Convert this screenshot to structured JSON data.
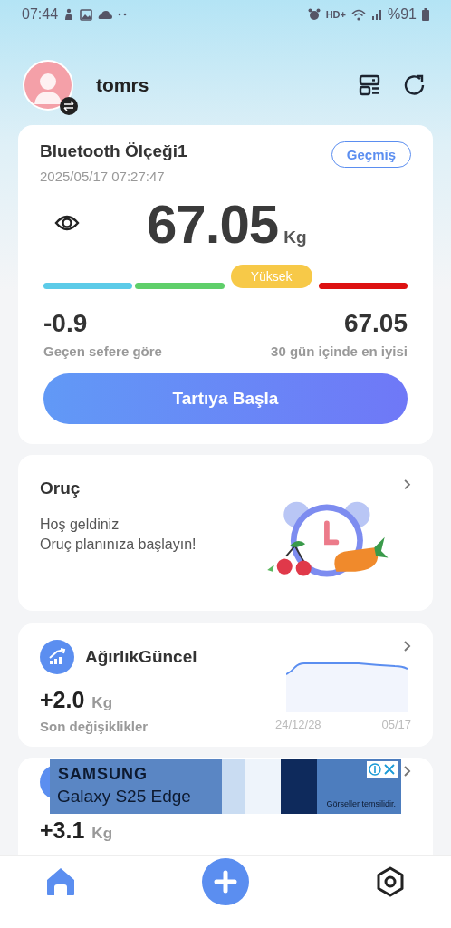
{
  "status_bar": {
    "time": "07:44",
    "network": "HD+",
    "battery": "%91"
  },
  "header": {
    "username": "tomrs"
  },
  "scale_card": {
    "title": "Bluetooth Ölçeği1",
    "history_button": "Geçmiş",
    "timestamp": "2025/05/17 07:27:47",
    "weight": "67.05",
    "unit": "Kg",
    "segments": [
      {
        "color": "#5ccbe8",
        "selected": false
      },
      {
        "color": "#5fcf6a",
        "selected": false
      },
      {
        "color": "#f7c948",
        "selected": true,
        "label": "Yüksek"
      },
      {
        "color": "#dd1111",
        "selected": false
      }
    ],
    "stats": [
      {
        "value": "-0.9",
        "label": "Geçen sefere göre"
      },
      {
        "value": "67.05",
        "label": "30 gün içinde en iyisi"
      }
    ],
    "start_button": "Tartıya Başla"
  },
  "fasting_card": {
    "title": "Oruç",
    "lines": [
      "Hoş geldiniz",
      "Oruç planınıza başlayın!"
    ]
  },
  "trend_card": {
    "title": "AğırlıkGüncel",
    "value": "+2.0",
    "unit": "Kg",
    "caption": "Son değişiklikler",
    "x_labels": [
      "24/12/28",
      "05/17"
    ]
  },
  "next_card": {
    "value": "+3.1",
    "unit": "Kg"
  },
  "ad": {
    "brand": "SAMSUNG",
    "product": "Galaxy S25 Edge",
    "disclaimer": "Görseller temsilidir."
  },
  "nav": [
    {
      "kind": "home",
      "selected": true
    },
    {
      "kind": "add",
      "selected": false
    },
    {
      "kind": "settings",
      "selected": false
    }
  ]
}
